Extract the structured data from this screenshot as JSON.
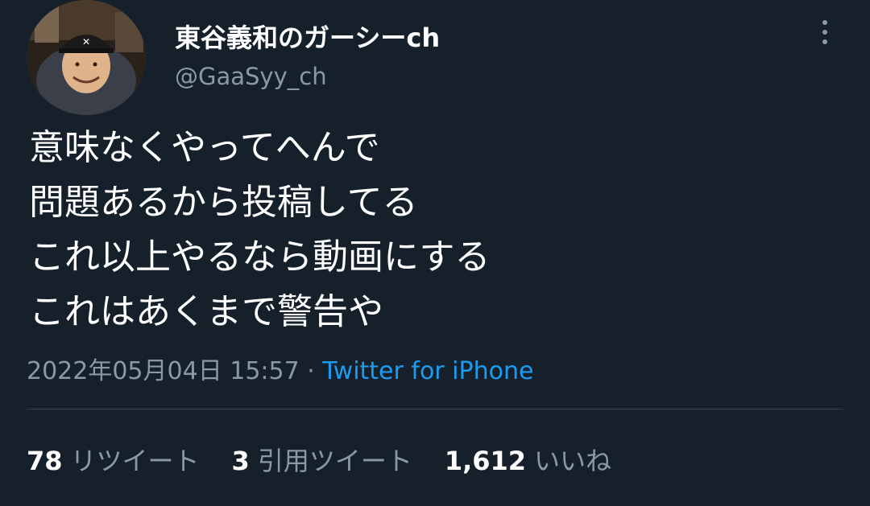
{
  "tweet": {
    "display_name": "東谷義和のガーシーch",
    "handle": "@GaaSyy_ch",
    "text_lines": [
      "意味なくやってへんで",
      "問題あるから投稿してる",
      "これ以上やるなら動画にする",
      "これはあくまで警告や"
    ],
    "timestamp": "2022年05月04日 15:57",
    "separator": " · ",
    "source": "Twitter for iPhone"
  },
  "stats": {
    "retweets_count": "78",
    "retweets_label": "リツイート",
    "quotes_count": "3",
    "quotes_label": "引用ツイート",
    "likes_count": "1,612",
    "likes_label": "いいね"
  },
  "icons": {
    "more": "more-vertical-icon"
  },
  "colors": {
    "background": "#15202b",
    "text": "#ffffff",
    "muted": "#8b98a5",
    "link": "#1d9bf0",
    "divider": "#38444d"
  }
}
